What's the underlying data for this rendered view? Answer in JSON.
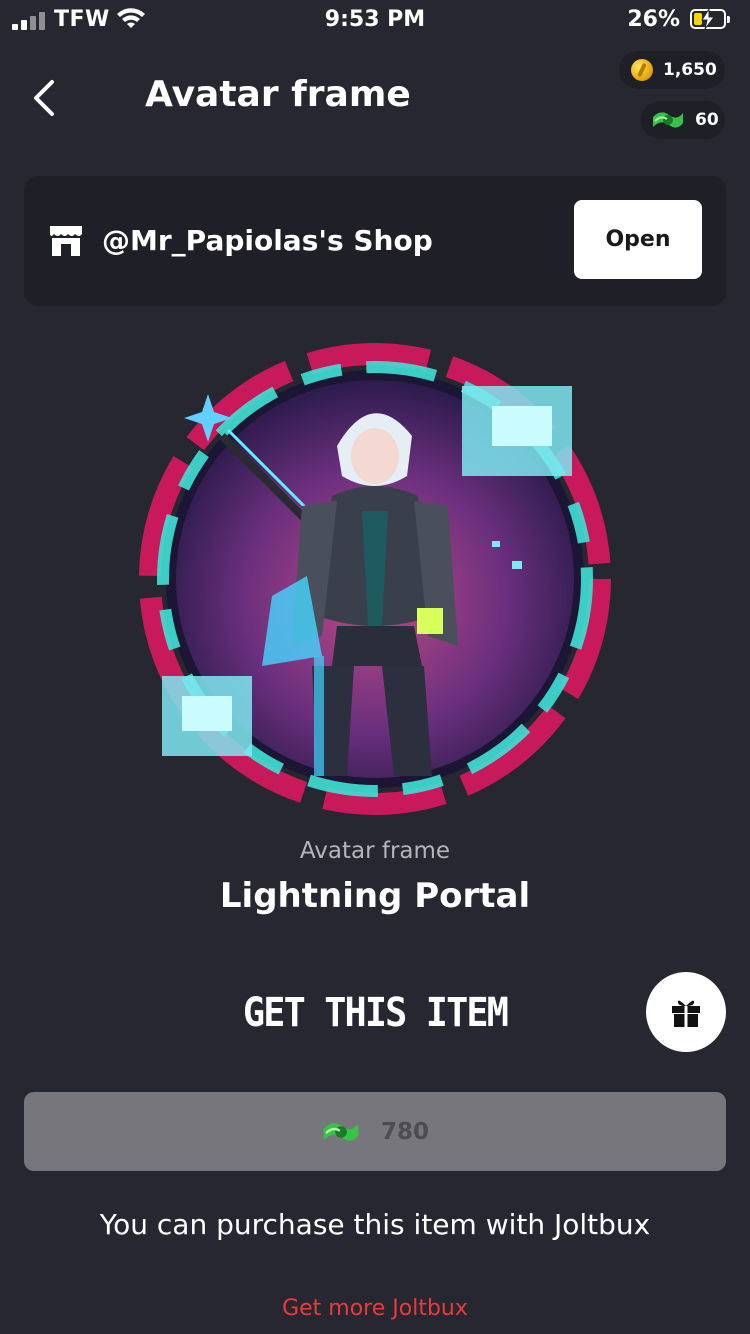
{
  "status_bar": {
    "carrier": "TFW",
    "time": "9:53 PM",
    "battery": "26%"
  },
  "header": {
    "title": "Avatar frame",
    "coins": "1,650",
    "joltbux": "60"
  },
  "shop": {
    "name": "@Mr_Papiolas's Shop",
    "open_label": "Open"
  },
  "item": {
    "type": "Avatar frame",
    "name": "Lightning Portal"
  },
  "purchase": {
    "heading": "GET THIS ITEM",
    "price": "780",
    "note": "You can purchase this item with Joltbux",
    "more_link": "Get more Joltbux"
  },
  "colors": {
    "background": "#272731",
    "card": "#1f1f27",
    "link": "#ea3a3a",
    "disabled_bar": "#77767c"
  },
  "icons": [
    "back-chevron-icon",
    "coin-icon",
    "joltbux-icon",
    "shop-icon",
    "gift-icon"
  ]
}
